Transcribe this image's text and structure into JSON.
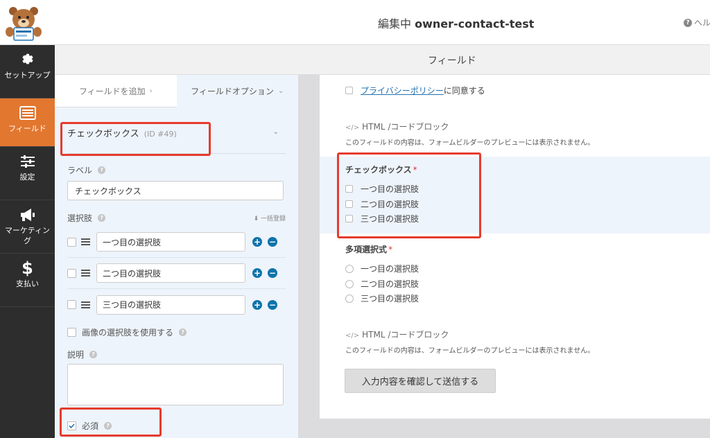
{
  "app": {
    "editing_prefix": "編集中",
    "form_name": "owner-contact-test",
    "help_label": "ヘル"
  },
  "sidebar": {
    "items": [
      {
        "label": "セットアップ",
        "icon": "gear-icon"
      },
      {
        "label": "フィールド",
        "icon": "fields-icon",
        "active": true
      },
      {
        "label": "設定",
        "icon": "sliders-icon"
      },
      {
        "label": "マーケティング",
        "icon": "megaphone-icon"
      },
      {
        "label": "支払い",
        "icon": "dollar-icon"
      }
    ]
  },
  "header": {
    "title": "フィールド"
  },
  "panel": {
    "tabs": [
      {
        "label": "フィールドを追加",
        "arrow": "›"
      },
      {
        "label": "フィールドオプション",
        "arrow": "⌄"
      }
    ],
    "field": {
      "name": "チェックボックス",
      "id_label": "(ID #49)"
    },
    "label_section": {
      "title": "ラベル",
      "value": "チェックボックス"
    },
    "choices_section": {
      "title": "選択肢",
      "bulk_add": "一括登録",
      "items": [
        "一つ目の選択肢",
        "二つ目の選択肢",
        "三つ目の選択肢"
      ]
    },
    "image_choices_label": "画像の選択肢を使用する",
    "description_label": "説明",
    "required_label": "必須"
  },
  "preview": {
    "privacy_link": "プライバシーポリシー",
    "privacy_suffix": "に同意する",
    "html_block_title": "HTML /コードブロック",
    "html_block_note": "このフィールドの内容は、フォームビルダーのプレビューには表示されません。",
    "checkbox_field": {
      "title": "チェックボックス",
      "required_mark": "*",
      "choices": [
        "一つ目の選択肢",
        "二つ目の選択肢",
        "三つ目の選択肢"
      ]
    },
    "multiple_choice_field": {
      "title": "多項選択式",
      "required_mark": "*",
      "choices": [
        "一つ目の選択肢",
        "二つ目の選択肢",
        "三つ目の選択肢"
      ]
    },
    "submit_label": "入力内容を確認して送信する"
  },
  "colors": {
    "accent": "#e27730",
    "highlight_box": "#e63b2e",
    "link": "#2271b1",
    "sidebar_bg": "#2d2d2d"
  }
}
